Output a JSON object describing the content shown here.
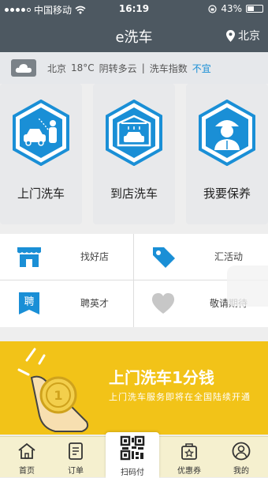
{
  "status_bar": {
    "carrier": "中国移动",
    "time": "16:19",
    "battery": "43%",
    "battery_level": 0.43
  },
  "nav": {
    "title": "e洗车",
    "city": "北京"
  },
  "weather": {
    "city": "北京",
    "temp": "18°C",
    "condition": "阴转多云",
    "separator": "|",
    "index_label": "洗车指数",
    "index_value": "不宜"
  },
  "services": [
    {
      "label": "上门洗车",
      "icon": "car-wash-person-icon"
    },
    {
      "label": "到店洗车",
      "icon": "car-garage-icon"
    },
    {
      "label": "我要保养",
      "icon": "mechanic-icon"
    }
  ],
  "grid": [
    {
      "label": "找好店",
      "icon": "shop-icon"
    },
    {
      "label": "汇活动",
      "icon": "tag-icon"
    },
    {
      "label": "聘英才",
      "icon": "recruit-bookmark-icon",
      "icon_text": "聘"
    },
    {
      "label": "敬请期待",
      "icon": "heart-icon"
    }
  ],
  "banner": {
    "title": "上门洗车1分钱",
    "subtitle": "上门洗车服务即将在全国陆续开通"
  },
  "tabbar": [
    {
      "label": "首页",
      "icon": "home-icon"
    },
    {
      "label": "订单",
      "icon": "order-icon"
    },
    {
      "label": "扫码付",
      "icon": "qr-code-icon"
    },
    {
      "label": "优惠券",
      "icon": "coupon-icon"
    },
    {
      "label": "我的",
      "icon": "profile-icon"
    }
  ],
  "colors": {
    "header": "#4d5861",
    "accent_blue": "#1a8fd6",
    "banner": "#f2c318"
  }
}
